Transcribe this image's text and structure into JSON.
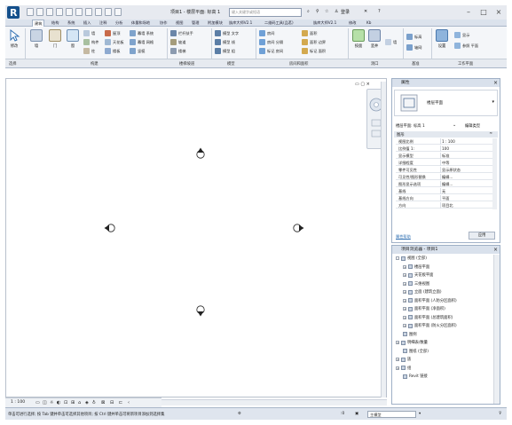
{
  "app": {
    "title": "项目1 - 楼层平面: 标高 1",
    "search_placeholder": "键入关键字或短语",
    "user": "登录",
    "help": "?"
  },
  "tabs": [
    "建筑",
    "结构",
    "系统",
    "插入",
    "注释",
    "分析",
    "体量和场地",
    "协作",
    "视图",
    "管理",
    "附加模块",
    "族库大师V2.1",
    "二维码工具(品茗)",
    "族库大师V2.1",
    "修改",
    "Kb"
  ],
  "ribbon": {
    "modify_label": "修改",
    "tools_col1": [
      "墙",
      "门",
      "窗"
    ],
    "tools_build": [
      "墙",
      "构件",
      "柱"
    ],
    "tools_build2": [
      "屋顶",
      "天花板",
      "楼板"
    ],
    "tools_build3": [
      "幕墙 系统",
      "幕墙 网格",
      "竖梃"
    ],
    "tools_circ": [
      "栏杆扶手",
      "坡道",
      "楼梯"
    ],
    "tools_model": [
      "模型 文字",
      "模型 线",
      "模型 组"
    ],
    "tools_room": [
      "房间",
      "房间 分隔",
      "标记 房间"
    ],
    "tools_area": [
      "面积",
      "面积 边界",
      "标记 面积"
    ],
    "tools_opening": [
      "按面",
      "竖井",
      "墙"
    ],
    "tools_datum": [
      "标高",
      "轴网"
    ],
    "tools_work": [
      "设置",
      "显示",
      "参照 平面"
    ],
    "group_labels": [
      "选择",
      "构建",
      "楼梯坡道",
      "模型",
      "房间和面积",
      "洞口",
      "基准",
      "工作平面"
    ]
  },
  "canvas": {
    "elevation_markers": [
      {
        "name": "north"
      },
      {
        "name": "west"
      },
      {
        "name": "east"
      },
      {
        "name": "south"
      }
    ]
  },
  "view_controls": {
    "scale": "1 : 100"
  },
  "properties": {
    "title": "属性",
    "type_name": "楼层平面",
    "selector_label": "楼层平面: 标高 1",
    "edit_type": "编辑类型",
    "section": "图形",
    "rows": [
      {
        "name": "视图比例",
        "value": "1 : 100"
      },
      {
        "name": "比例值 1:",
        "value": "100"
      },
      {
        "name": "显示模型",
        "value": "标准"
      },
      {
        "name": "详细程度",
        "value": "中等"
      },
      {
        "name": "零件可见性",
        "value": "显示原状态"
      },
      {
        "name": "可见性/图形替换",
        "value": "编辑..."
      },
      {
        "name": "图形显示选项",
        "value": "编辑..."
      },
      {
        "name": "基线",
        "value": "无"
      },
      {
        "name": "基线方向",
        "value": "平面"
      },
      {
        "name": "方向",
        "value": "项目北"
      }
    ],
    "help_link": "属性帮助",
    "apply": "应用"
  },
  "browser": {
    "title": "项目浏览器 - 项目1",
    "items": [
      {
        "label": "视图 (全部)",
        "level": 0,
        "toggle": "-"
      },
      {
        "label": "楼层平面",
        "level": 1,
        "toggle": "+"
      },
      {
        "label": "天花板平面",
        "level": 1,
        "toggle": "+"
      },
      {
        "label": "三维视图",
        "level": 1,
        "toggle": "+"
      },
      {
        "label": "立面 (建筑立面)",
        "level": 1,
        "toggle": "+"
      },
      {
        "label": "面积平面 (人防分区面积)",
        "level": 1,
        "toggle": "+"
      },
      {
        "label": "面积平面 (净面积)",
        "level": 1,
        "toggle": "+"
      },
      {
        "label": "面积平面 (总建筑面积)",
        "level": 1,
        "toggle": "+"
      },
      {
        "label": "面积平面 (防火分区面积)",
        "level": 1,
        "toggle": "+"
      },
      {
        "label": "图例",
        "level": 0,
        "toggle": ""
      },
      {
        "label": "明细表/数量",
        "level": 0,
        "toggle": "+"
      },
      {
        "label": "图纸 (全部)",
        "level": 0,
        "toggle": ""
      },
      {
        "label": "族",
        "level": 0,
        "toggle": "+"
      },
      {
        "label": "组",
        "level": 0,
        "toggle": "+"
      },
      {
        "label": "Revit 链接",
        "level": 0,
        "toggle": ""
      }
    ]
  },
  "statusbar": {
    "message": "单击可进行选择; 按 Tab 键并单击可选择其他项目; 按 Ctrl 键并单击可将新项目添加到选择集",
    "filter": "主模型",
    "zero": ":0"
  },
  "colors": {
    "accent": "#2f6fb2",
    "ribbon_bg": "#f4f6f9",
    "panel_header": "#d9e1ec"
  }
}
